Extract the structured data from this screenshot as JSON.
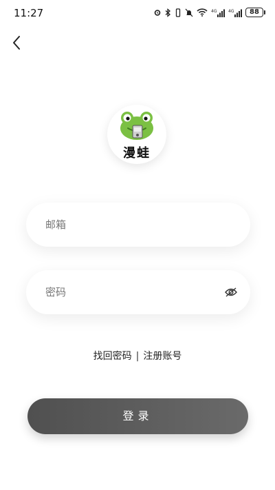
{
  "status_bar": {
    "time": "11:27",
    "battery": "88",
    "network_label_1": "4G",
    "network_label_2": "4G"
  },
  "logo": {
    "text": "漫蛙",
    "colors": {
      "frog_green": "#7bc043",
      "frog_dark": "#3f7d1e"
    }
  },
  "form": {
    "email_placeholder": "邮箱",
    "password_placeholder": "密码"
  },
  "links": {
    "forgot_password": "找回密码",
    "separator": "|",
    "register": "注册账号"
  },
  "login_button": {
    "label": "登录"
  },
  "colors": {
    "button_start": "#505050",
    "button_end": "#6a6a6a"
  }
}
